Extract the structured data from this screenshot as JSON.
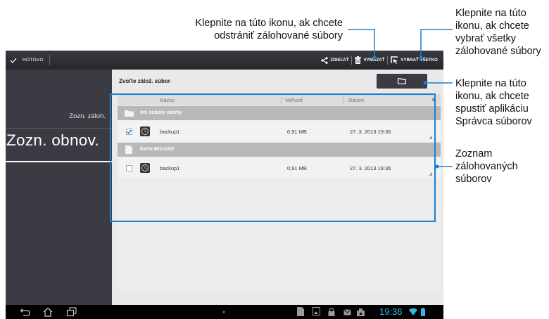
{
  "callouts": {
    "delete": "Klepnite na túto ikonu, ak chcete odstrániť zálohované súbory",
    "select_all": "Klepnite na túto ikonu, ak chcete vybrať všetky zálohované súbory",
    "file_manager": "Klepnite na túto ikonu, ak chcete spustiť aplikáciu Správca súborov",
    "list": "Zoznam zálohovaných súborov"
  },
  "action_bar": {
    "done_label": "HOTOVO",
    "share_label": "ZDIEĽAŤ",
    "delete_label": "VYMAZAŤ",
    "select_all_label": "VYBRAŤ VŠETKO"
  },
  "sidebar": {
    "items": [
      {
        "label": "Zozn. záloh."
      },
      {
        "label": "Zozn. obnov."
      }
    ]
  },
  "content": {
    "title": "Zvoľte zálož. súbor",
    "columns": {
      "name": "Názov",
      "size": "Veľkosť",
      "date": "Dátum"
    },
    "groups": [
      {
        "label": "Int. súbory zálohy",
        "rows": [
          {
            "name": "backup1",
            "size": "0,91 MB",
            "date": "27. 3. 2013 19:36",
            "checked": true
          }
        ]
      },
      {
        "label": "Karta MicroSD",
        "rows": [
          {
            "name": "backup1",
            "size": "0,91 MB",
            "date": "27. 3. 2013 19:36",
            "checked": false
          }
        ]
      }
    ]
  },
  "status_bar": {
    "time": "19:36"
  },
  "colors": {
    "accent": "#33b5e5",
    "highlight": "#1a7fd4",
    "sidebar": "#3b3b44"
  }
}
